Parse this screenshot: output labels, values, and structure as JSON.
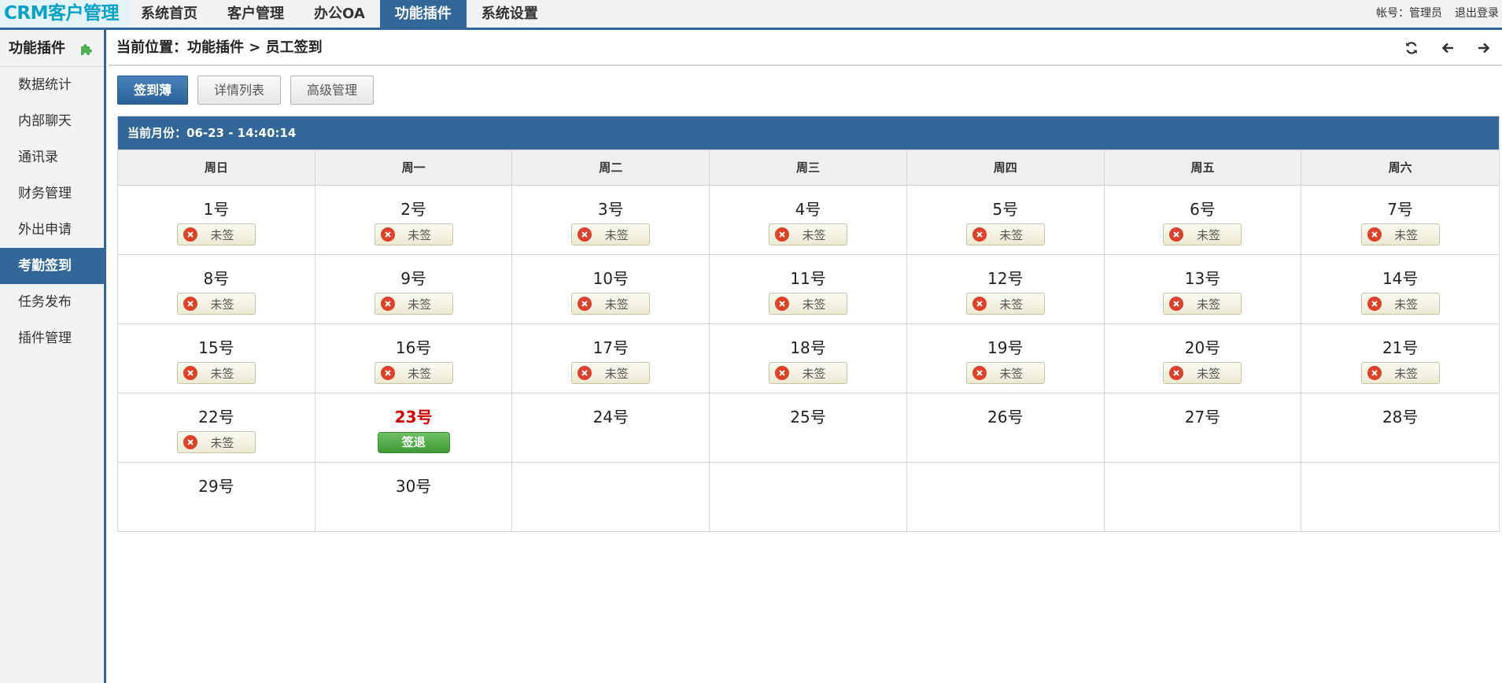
{
  "app": {
    "logo": "CRM客户管理"
  },
  "nav": {
    "items": [
      {
        "label": "系统首页",
        "active": false
      },
      {
        "label": "客户管理",
        "active": false
      },
      {
        "label": "办公OA",
        "active": false
      },
      {
        "label": "功能插件",
        "active": true
      },
      {
        "label": "系统设置",
        "active": false
      }
    ],
    "account": "帐号：管理员",
    "logout": "退出登录"
  },
  "sidebar": {
    "title": "功能插件",
    "title_icon": "puzzle-icon",
    "items": [
      {
        "label": "数据统计",
        "active": false
      },
      {
        "label": "内部聊天",
        "active": false
      },
      {
        "label": "通讯录",
        "active": false
      },
      {
        "label": "财务管理",
        "active": false
      },
      {
        "label": "外出申请",
        "active": false
      },
      {
        "label": "考勤签到",
        "active": true
      },
      {
        "label": "任务发布",
        "active": false
      },
      {
        "label": "插件管理",
        "active": false
      }
    ]
  },
  "breadcrumb": {
    "text": "当前位置：功能插件 > 员工签到"
  },
  "toolbar": {
    "icons": [
      "refresh-icon",
      "arrow-left-icon",
      "arrow-right-icon"
    ]
  },
  "tabs": [
    {
      "label": "签到薄",
      "active": true
    },
    {
      "label": "详情列表",
      "active": false
    },
    {
      "label": "高级管理",
      "active": false
    }
  ],
  "calendar": {
    "header": "当前月份：06-23 - 14:40:14",
    "weekdays": [
      "周日",
      "周一",
      "周二",
      "周三",
      "周四",
      "周五",
      "周六"
    ],
    "unsigned_label": "未签",
    "signout_label": "签退",
    "weeks": [
      [
        {
          "day": "1号",
          "status": "unsigned"
        },
        {
          "day": "2号",
          "status": "unsigned"
        },
        {
          "day": "3号",
          "status": "unsigned"
        },
        {
          "day": "4号",
          "status": "unsigned"
        },
        {
          "day": "5号",
          "status": "unsigned"
        },
        {
          "day": "6号",
          "status": "unsigned"
        },
        {
          "day": "7号",
          "status": "unsigned"
        }
      ],
      [
        {
          "day": "8号",
          "status": "unsigned"
        },
        {
          "day": "9号",
          "status": "unsigned"
        },
        {
          "day": "10号",
          "status": "unsigned"
        },
        {
          "day": "11号",
          "status": "unsigned"
        },
        {
          "day": "12号",
          "status": "unsigned"
        },
        {
          "day": "13号",
          "status": "unsigned"
        },
        {
          "day": "14号",
          "status": "unsigned"
        }
      ],
      [
        {
          "day": "15号",
          "status": "unsigned"
        },
        {
          "day": "16号",
          "status": "unsigned"
        },
        {
          "day": "17号",
          "status": "unsigned"
        },
        {
          "day": "18号",
          "status": "unsigned"
        },
        {
          "day": "19号",
          "status": "unsigned"
        },
        {
          "day": "20号",
          "status": "unsigned"
        },
        {
          "day": "21号",
          "status": "unsigned"
        }
      ],
      [
        {
          "day": "22号",
          "status": "unsigned"
        },
        {
          "day": "23号",
          "status": "today"
        },
        {
          "day": "24号",
          "status": "none"
        },
        {
          "day": "25号",
          "status": "none"
        },
        {
          "day": "26号",
          "status": "none"
        },
        {
          "day": "27号",
          "status": "none"
        },
        {
          "day": "28号",
          "status": "none"
        }
      ],
      [
        {
          "day": "29号",
          "status": "none"
        },
        {
          "day": "30号",
          "status": "none"
        },
        {
          "day": "",
          "status": "empty"
        },
        {
          "day": "",
          "status": "empty"
        },
        {
          "day": "",
          "status": "empty"
        },
        {
          "day": "",
          "status": "empty"
        },
        {
          "day": "",
          "status": "empty"
        }
      ]
    ]
  },
  "colors": {
    "primary": "#336699",
    "today": "#d40000",
    "signout": "#4caf50",
    "unsigned_x": "#e0402a"
  }
}
